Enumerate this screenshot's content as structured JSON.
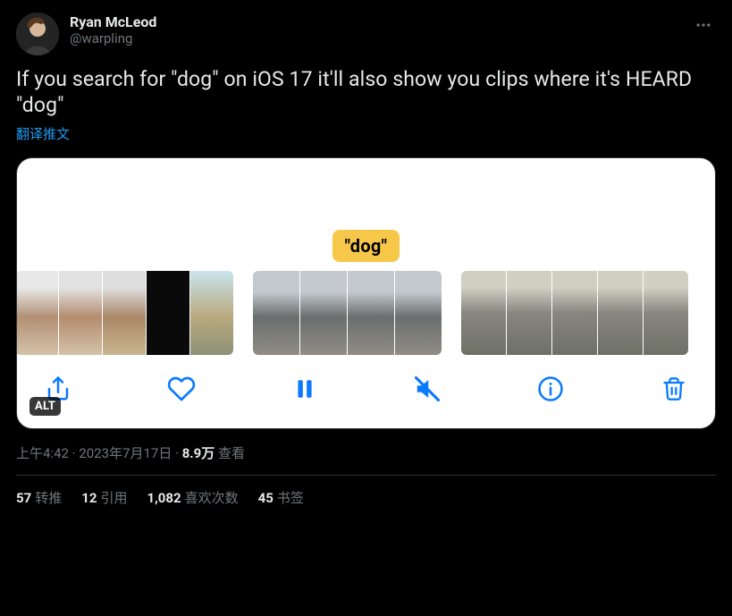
{
  "user": {
    "display_name": "Ryan McLeod",
    "handle": "@warpling"
  },
  "tweet_text": "If you search for \"dog\" on iOS 17 it'll also show you clips where it's HEARD \"dog\"",
  "translate_label": "翻译推文",
  "media": {
    "caption_label": "\"dog\"",
    "alt_badge": "ALT"
  },
  "meta": {
    "time": "上午4:42",
    "date": "2023年7月17日",
    "views_count": "8.9万",
    "views_label": "查看"
  },
  "stats": {
    "retweets": {
      "count": "57",
      "label": "转推"
    },
    "quotes": {
      "count": "12",
      "label": "引用"
    },
    "likes": {
      "count": "1,082",
      "label": "喜欢次数"
    },
    "bookmarks": {
      "count": "45",
      "label": "书签"
    }
  }
}
